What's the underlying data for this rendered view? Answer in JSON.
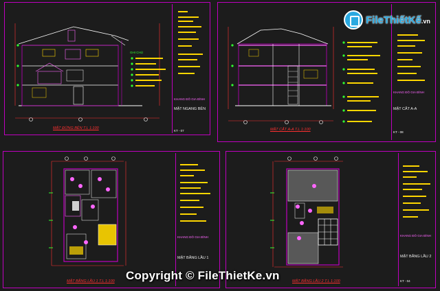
{
  "watermark": {
    "brand": "FileThiếtKế",
    "domain_suffix": ".vn",
    "copyright": "Copyright © FileThietKe.vn"
  },
  "sheets": [
    {
      "caption": "MẶT ĐỨNG BÊN T.L 1:100",
      "tb_label": "MẶT NGANG BÊN",
      "tb_company": "KHANG ĐÔ GIA ĐÌNH",
      "tb_code": "KT - 07"
    },
    {
      "caption": "MẶT CẮT A-A T.L 1:100",
      "tb_label": "MẶT CẮT A-A",
      "tb_company": "KHANG ĐÔ GIA ĐÌNH",
      "tb_code": "KT - 08"
    },
    {
      "caption": "MẶT BẰNG LẦU 1 T.L 1:100",
      "tb_label": "MẶT BẰNG LẦU 1",
      "tb_company": "KHANG ĐÔ GIA ĐÌNH",
      "tb_code": ""
    },
    {
      "caption": "MẶT BẰNG LẦU 2 T.L 1:100",
      "tb_label": "MẶT BẰNG LẦU 2",
      "tb_company": "KHANG ĐÔ GIA ĐÌNH",
      "tb_code": "KT - 04"
    }
  ],
  "legend_title": "GHI CHÚ",
  "colors": {
    "background": "#1c1c1c",
    "frame": "#c000c0",
    "text_yellow": "#ffd700",
    "dim_red": "#ff3030",
    "grid_green": "#30ff30",
    "brand_blue": "#2aa9e0"
  }
}
